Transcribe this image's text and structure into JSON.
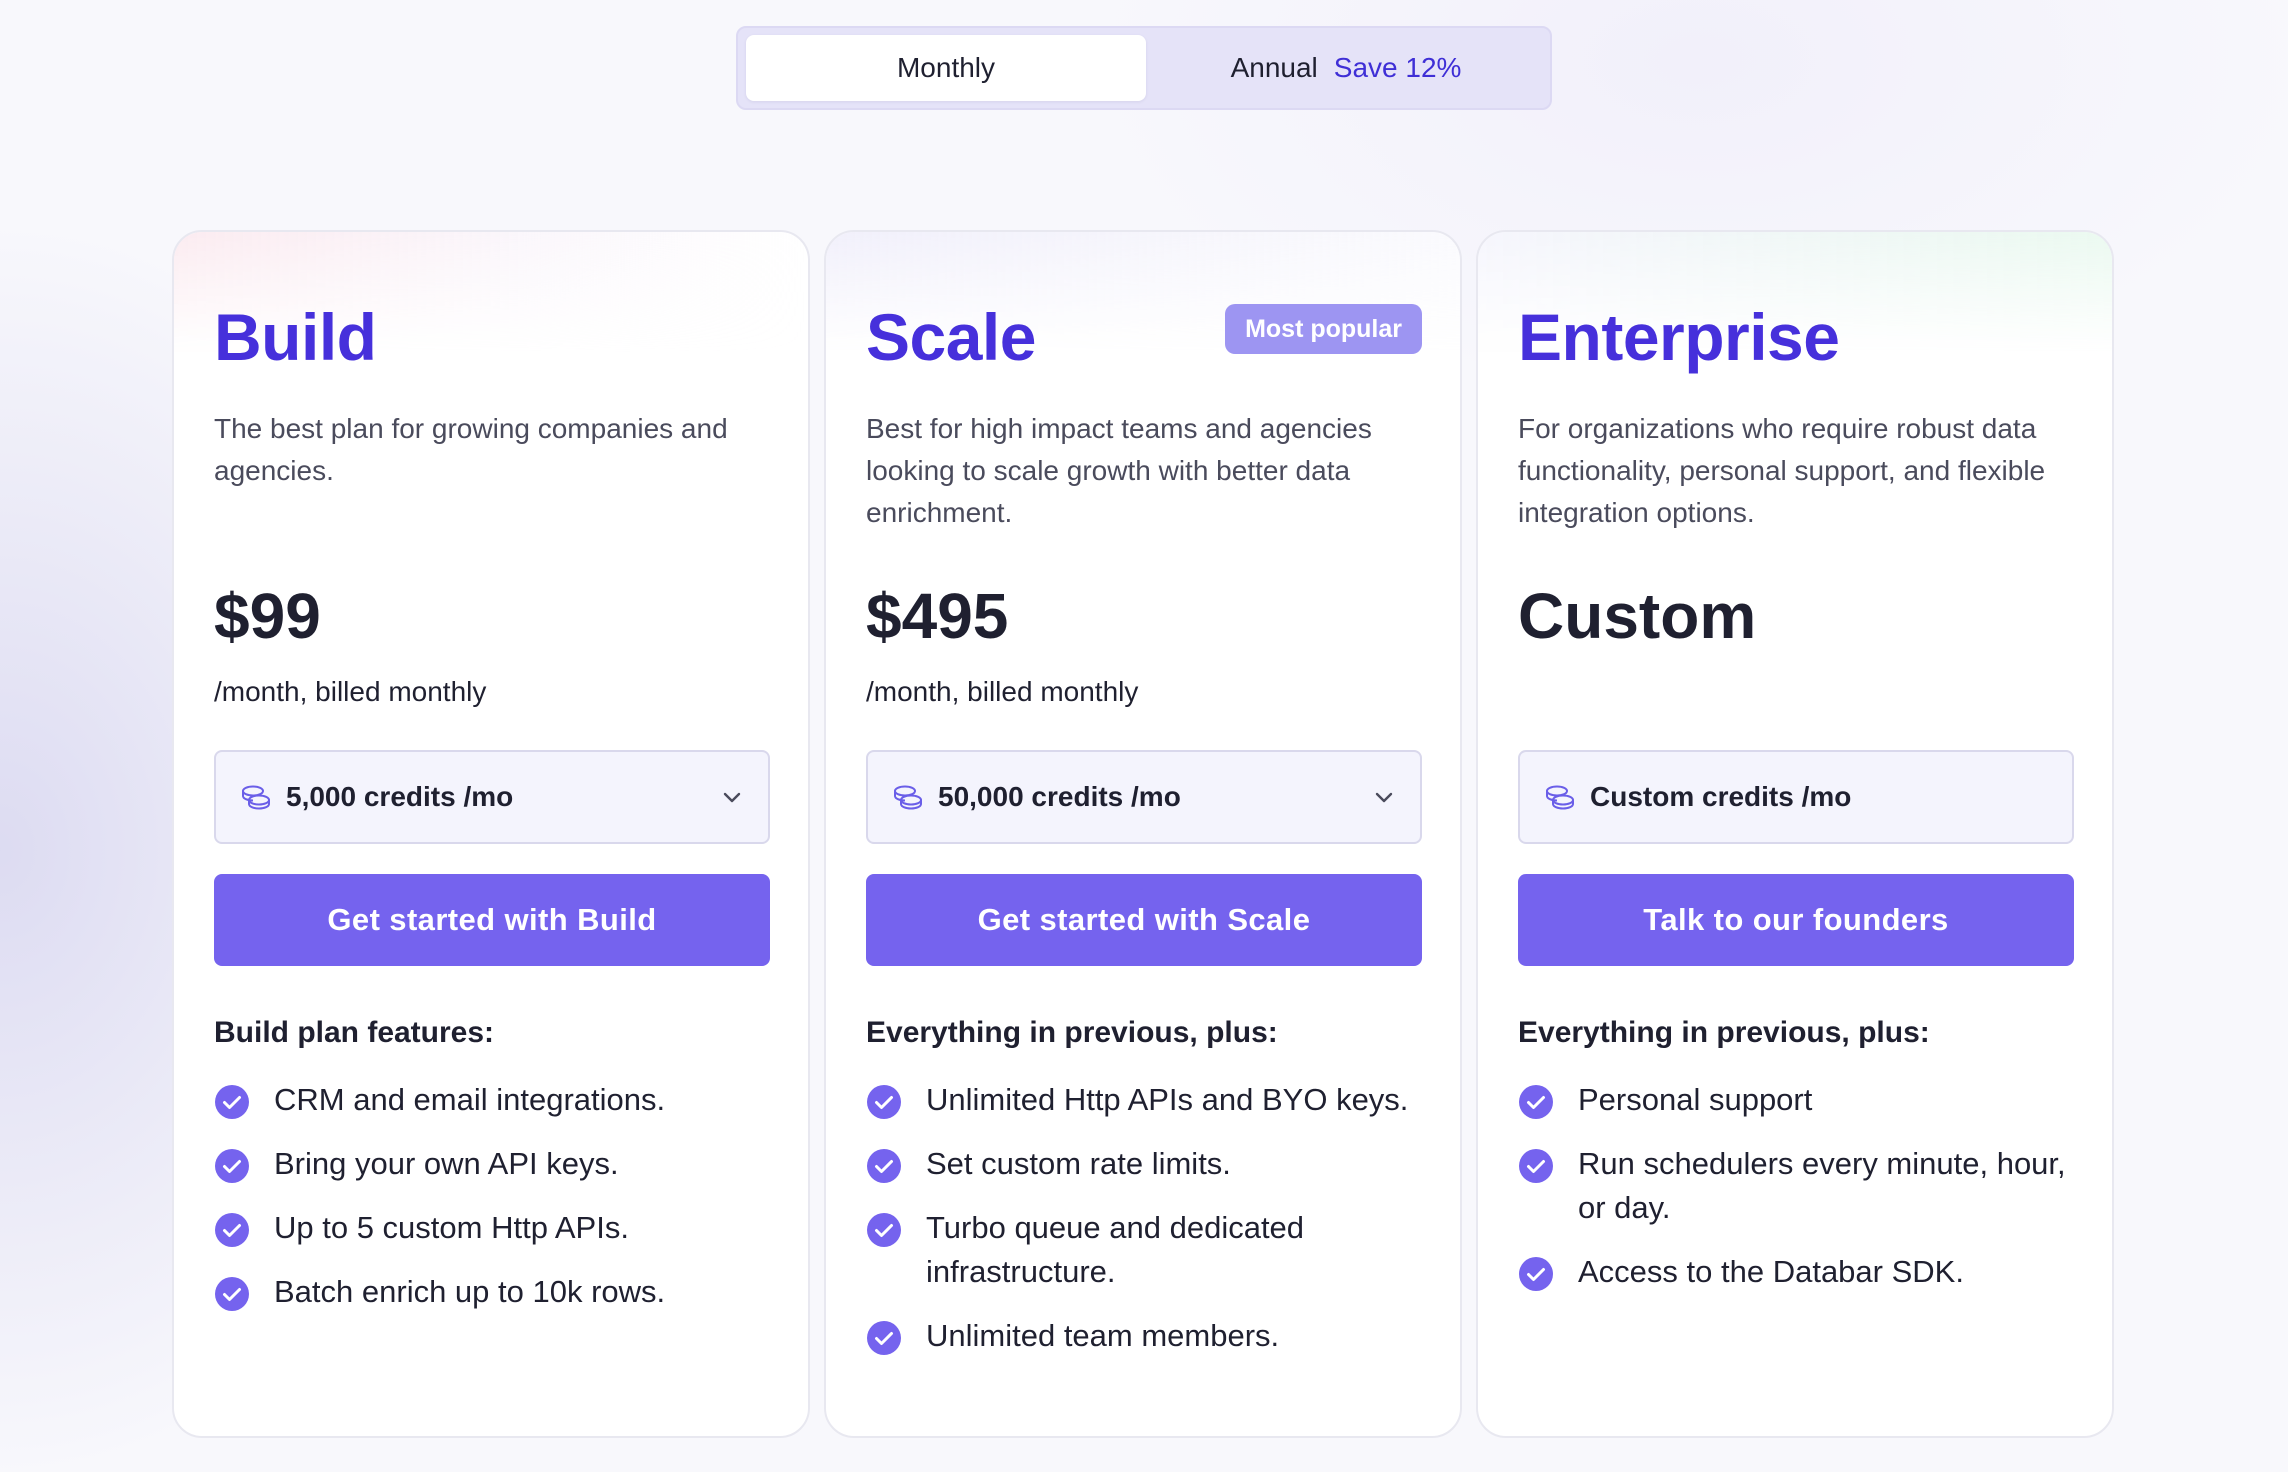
{
  "toggle": {
    "monthly_label": "Monthly",
    "annual_label": "Annual",
    "save_label": "Save 12%",
    "selected": "Monthly"
  },
  "colors": {
    "accent": "#4630db",
    "button": "#7563ee",
    "badge": "#9d95f2",
    "check": "#7563ee"
  },
  "plans": [
    {
      "name": "Build",
      "description": "The best plan for growing companies and agencies.",
      "price": "$99",
      "price_note": "/month, billed monthly",
      "credits": "5,000 credits /mo",
      "credits_icon": "coins-icon",
      "has_dropdown": true,
      "cta": "Get started with Build",
      "features_title": "Build plan features:",
      "features": [
        "CRM and email integrations.",
        "Bring your own API keys.",
        "Up to 5 custom Http APIs.",
        "Batch enrich up to 10k rows."
      ]
    },
    {
      "name": "Scale",
      "badge": "Most popular",
      "description": "Best for high impact teams and agencies looking to scale growth with better data enrichment.",
      "price": "$495",
      "price_note": "/month, billed monthly",
      "credits": "50,000 credits /mo",
      "credits_icon": "coins-icon",
      "has_dropdown": true,
      "cta": "Get started with Scale",
      "features_title": "Everything in previous, plus:",
      "features": [
        "Unlimited Http APIs and BYO keys.",
        "Set custom rate limits.",
        "Turbo queue and dedicated infrastructure.",
        "Unlimited team members."
      ]
    },
    {
      "name": "Enterprise",
      "description": "For organizations who require robust data functionality, personal support, and flexible integration options.",
      "price": "Custom",
      "credits": "Custom credits /mo",
      "credits_icon": "coins-icon",
      "has_dropdown": false,
      "cta": "Talk to our founders",
      "features_title": "Everything in previous, plus:",
      "features": [
        "Personal support",
        "Run schedulers every minute, hour, or day.",
        "Access to the Databar SDK."
      ]
    }
  ]
}
